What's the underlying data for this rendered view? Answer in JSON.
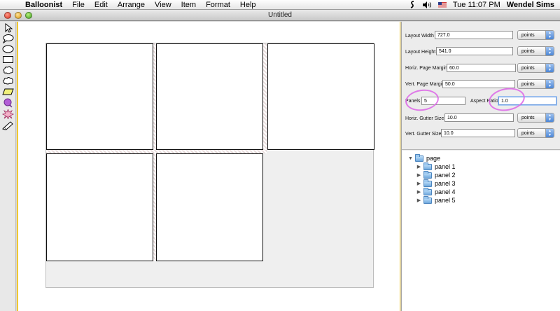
{
  "menubar": {
    "app_name": "Balloonist",
    "menus": [
      "File",
      "Edit",
      "Arrange",
      "View",
      "Item",
      "Format",
      "Help"
    ],
    "clock": "Tue 11:07 PM",
    "user": "Wendel Sims"
  },
  "window": {
    "title": "Untitled"
  },
  "toolbox": {
    "tools": [
      "arrow-tool",
      "speech-balloon-tool",
      "oval-tool",
      "rectangle-tool",
      "cloud-tool",
      "thought-cloud-tool",
      "caption-tool",
      "whisper-balloon-tool",
      "burst-tool",
      "scroll-tool"
    ]
  },
  "layout": {
    "layout_width": {
      "label": "Layout Width",
      "value": "727.0",
      "unit": "points"
    },
    "layout_height": {
      "label": "Layout Height",
      "value": "541.0",
      "unit": "points"
    },
    "horiz_margin": {
      "label": "Horiz. Page Margin",
      "value": "60.0",
      "unit": "points"
    },
    "vert_margin": {
      "label": "Vert. Page Margin",
      "value": "50.0",
      "unit": "points"
    },
    "panels": {
      "label": "Panels",
      "value": "5"
    },
    "aspect_ratio": {
      "label": "Aspect Ratio",
      "value": "1.0"
    },
    "horiz_gutter": {
      "label": "Horiz. Gutter Size",
      "value": "10.0",
      "unit": "points"
    },
    "vert_gutter": {
      "label": "Vert. Gutter Size",
      "value": "10.0",
      "unit": "points"
    }
  },
  "outline": {
    "root": "page",
    "children": [
      "panel 1",
      "panel 2",
      "panel 3",
      "panel 4",
      "panel 5"
    ]
  },
  "colors": {
    "annotation": "#dd66e8",
    "canvas_border": "#f0c830",
    "popup_accent": "#4b86d6"
  }
}
